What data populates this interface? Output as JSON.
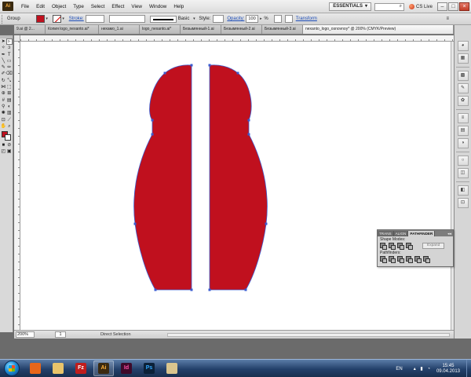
{
  "menubar": {
    "logo": "Ai",
    "menus": [
      "File",
      "Edit",
      "Object",
      "Type",
      "Select",
      "Effect",
      "View",
      "Window",
      "Help"
    ],
    "workspace": "ESSENTIALS",
    "cs_live": "CS Live",
    "window_buttons": [
      "–",
      "□",
      "×"
    ]
  },
  "controlbar": {
    "selection": "Group",
    "stroke_label": "Stroke:",
    "brush": "Basic",
    "style_label": "Style:",
    "opacity_label": "Opacity:",
    "opacity_value": "100",
    "opacity_unit": "%",
    "transform_label": "Transform",
    "fill_color": "#c0101e"
  },
  "tabs": [
    {
      "label": "9.ai @ 2...",
      "active": false
    },
    {
      "label": "Копия logo_nexanto.ai*",
      "active": false
    },
    {
      "label": "нехамо_1.ai",
      "active": false
    },
    {
      "label": "logo_nexanto.ai*",
      "active": false
    },
    {
      "label": "Безымянный-1.ai",
      "active": false
    },
    {
      "label": "Безымянный-2.ai",
      "active": false
    },
    {
      "label": "Безымянный-3.ai",
      "active": false
    },
    {
      "label": "nexanto_logo_osnovnoy* @ 200% (CMYK/Preview)",
      "active": true
    }
  ],
  "artwork": {
    "fill": "#c0101e",
    "selection_color": "#3a5bd0"
  },
  "statusbar": {
    "zoom": "200%",
    "page": "1",
    "tool": "Direct Selection"
  },
  "panel": {
    "tabs": [
      "TRANS",
      "ALIGN",
      "PATHFINDER"
    ],
    "shape_modes_label": "Shape Modes:",
    "pathfinders_label": "Pathfinders:",
    "expand_label": "Expand"
  },
  "taskbar": {
    "apps": [
      {
        "name": "firefox",
        "glyph": "",
        "bg": "#e8661a",
        "color": "#fff"
      },
      {
        "name": "explorer",
        "glyph": "",
        "bg": "#e9c46a",
        "color": "#fff"
      },
      {
        "name": "filezilla",
        "glyph": "Fz",
        "bg": "#bf1d1d",
        "color": "#fff"
      },
      {
        "name": "illustrator",
        "glyph": "Ai",
        "bg": "#3a2a10",
        "color": "#ffb13b"
      },
      {
        "name": "indesign",
        "glyph": "Id",
        "bg": "#3e0a2a",
        "color": "#ff4fa6"
      },
      {
        "name": "photoshop",
        "glyph": "Ps",
        "bg": "#0b2138",
        "color": "#31a8ff"
      },
      {
        "name": "image-viewer",
        "glyph": "",
        "bg": "#d9c58e",
        "color": "#fff"
      }
    ],
    "lang": "EN",
    "time": "15:45",
    "date": "09.04.2013"
  }
}
